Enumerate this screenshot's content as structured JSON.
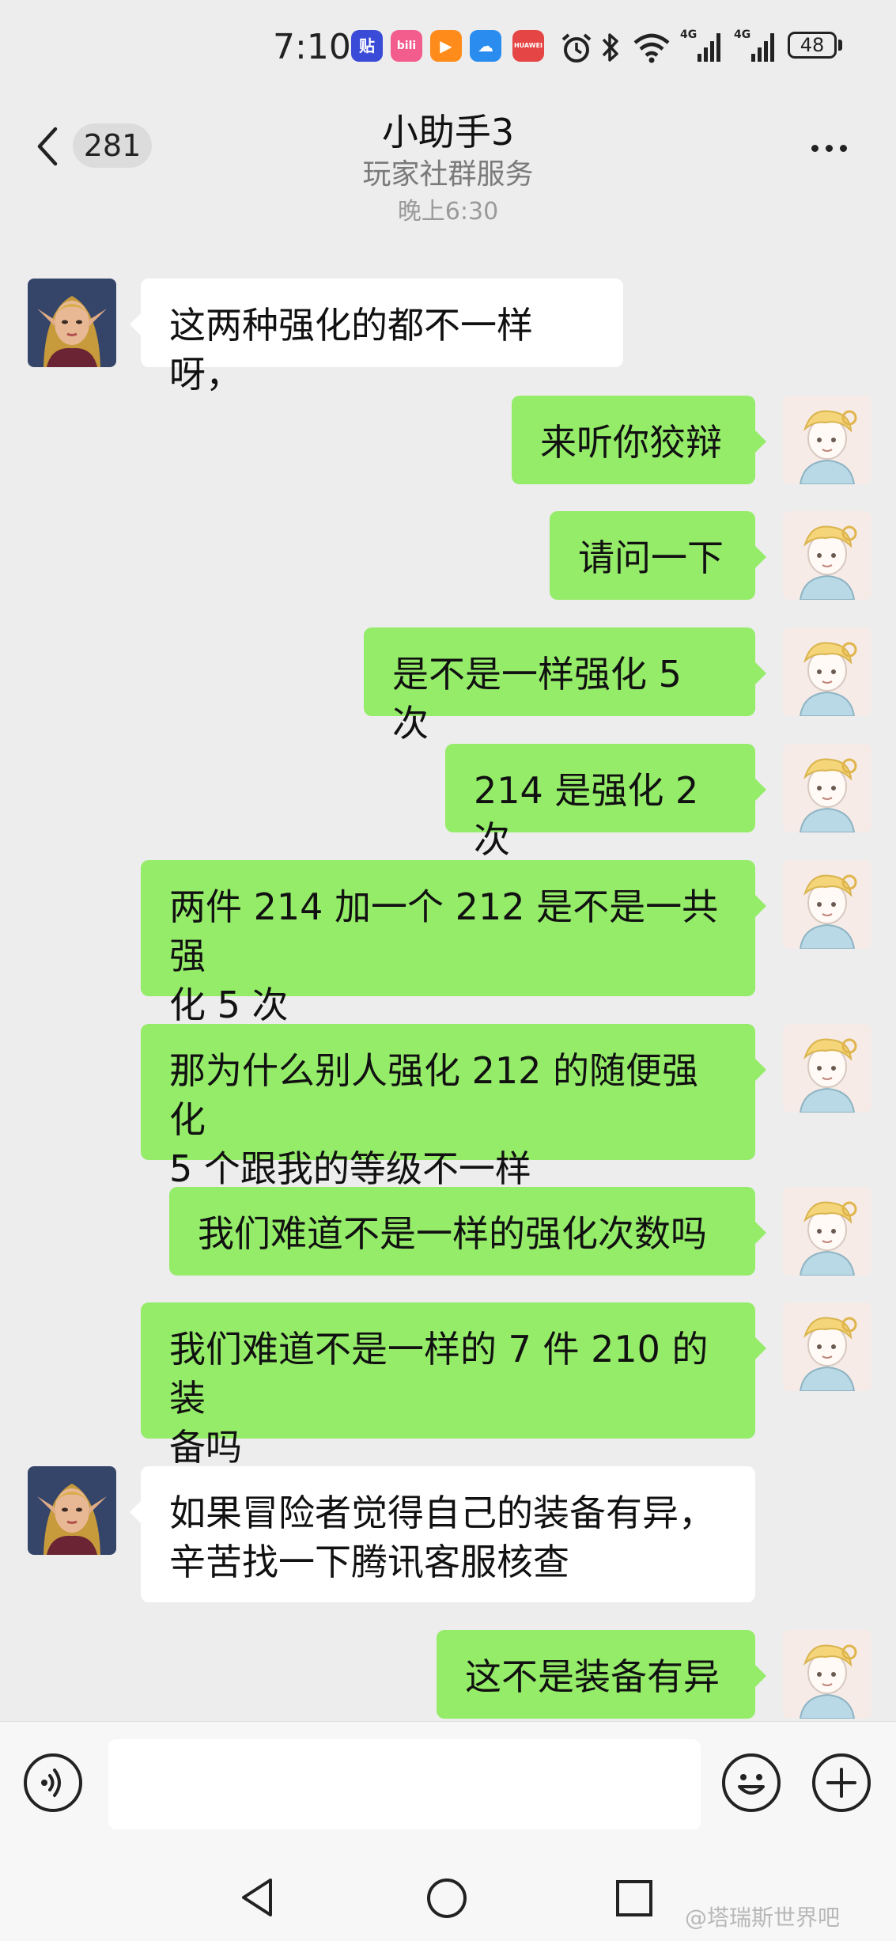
{
  "status_bar": {
    "time": "7:10",
    "app_icons": [
      {
        "name": "tieba-app-icon",
        "text": "贴",
        "color": "#3a4bd8"
      },
      {
        "name": "bilibili-app-icon",
        "text": "bili",
        "color": "#f25d8e"
      },
      {
        "name": "video-app-icon",
        "text": "▶",
        "color": "#ff8c1a"
      },
      {
        "name": "weather-app-icon",
        "text": "☁",
        "color": "#2b8cf0"
      },
      {
        "name": "huawei-app-icon",
        "text": "HUAWEI",
        "color": "#e64545"
      }
    ],
    "network_1": "4G",
    "network_2": "4G",
    "battery": "48"
  },
  "header": {
    "unread_count": "281",
    "title": "小助手3",
    "subtitle": "玩家社群服务"
  },
  "chat": {
    "timestamp": "晚上6:30",
    "messages": [
      {
        "side": "in",
        "text": "这两种强化的都不一样呀，"
      },
      {
        "side": "out",
        "text": "来听你狡辩"
      },
      {
        "side": "out",
        "text": "请问一下"
      },
      {
        "side": "out",
        "text": "是不是一样强化 5 次"
      },
      {
        "side": "out",
        "text": "214 是强化 2 次"
      },
      {
        "side": "out",
        "text": "两件 214 加一个 212 是不是一共强\n化 5 次"
      },
      {
        "side": "out",
        "text": "那为什么别人强化 212 的随便强化\n5 个跟我的等级不一样"
      },
      {
        "side": "out",
        "text": "我们难道不是一样的强化次数吗"
      },
      {
        "side": "out",
        "text": "我们难道不是一样的 7 件 210 的装\n备吗"
      },
      {
        "side": "in",
        "text": "如果冒险者觉得自己的装备有异，\n辛苦找一下腾讯客服核查"
      },
      {
        "side": "out",
        "text": "这不是装备有异"
      }
    ]
  },
  "input_bar": {
    "placeholder": ""
  },
  "watermark": "@塔瑞斯世界吧",
  "colors": {
    "background": "#ededed",
    "outgoing_bubble": "#95ec69",
    "incoming_bubble": "#ffffff"
  }
}
